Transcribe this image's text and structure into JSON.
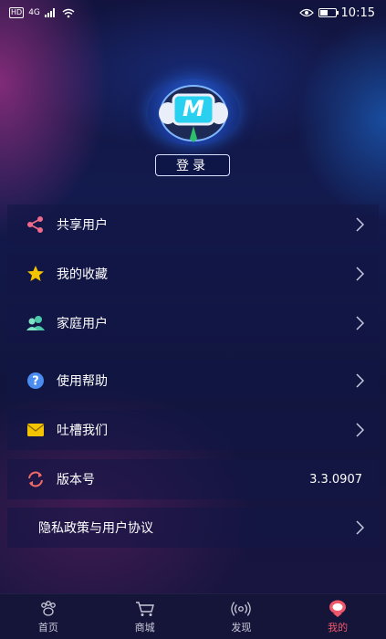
{
  "status_bar": {
    "badge": "HD",
    "network": "4G",
    "time": "10:15"
  },
  "profile": {
    "login_label": "登录",
    "avatar_letter": "M"
  },
  "menu": [
    {
      "label": "共享用户",
      "icon": "share-icon"
    },
    {
      "label": "我的收藏",
      "icon": "star-icon"
    },
    {
      "label": "家庭用户",
      "icon": "family-users-icon"
    },
    {
      "label": "使用帮助",
      "icon": "help-icon"
    },
    {
      "label": "吐槽我们",
      "icon": "mail-icon"
    },
    {
      "label": "版本号",
      "icon": "refresh-icon",
      "value": "3.3.0907"
    },
    {
      "label": "隐私政策与用户协议"
    }
  ],
  "tabs": [
    {
      "label": "首页",
      "icon": "home-paw-icon"
    },
    {
      "label": "商城",
      "icon": "cart-icon"
    },
    {
      "label": "发现",
      "icon": "broadcast-icon"
    },
    {
      "label": "我的",
      "icon": "profile-icon",
      "active": true
    }
  ],
  "colors": {
    "accent_active": "#f0576a",
    "share": "#f06a8a",
    "star": "#f5c400",
    "family": "#4cc9a8",
    "help": "#4a8cf0",
    "mail": "#f5c400",
    "refresh": "#f06a6a"
  }
}
